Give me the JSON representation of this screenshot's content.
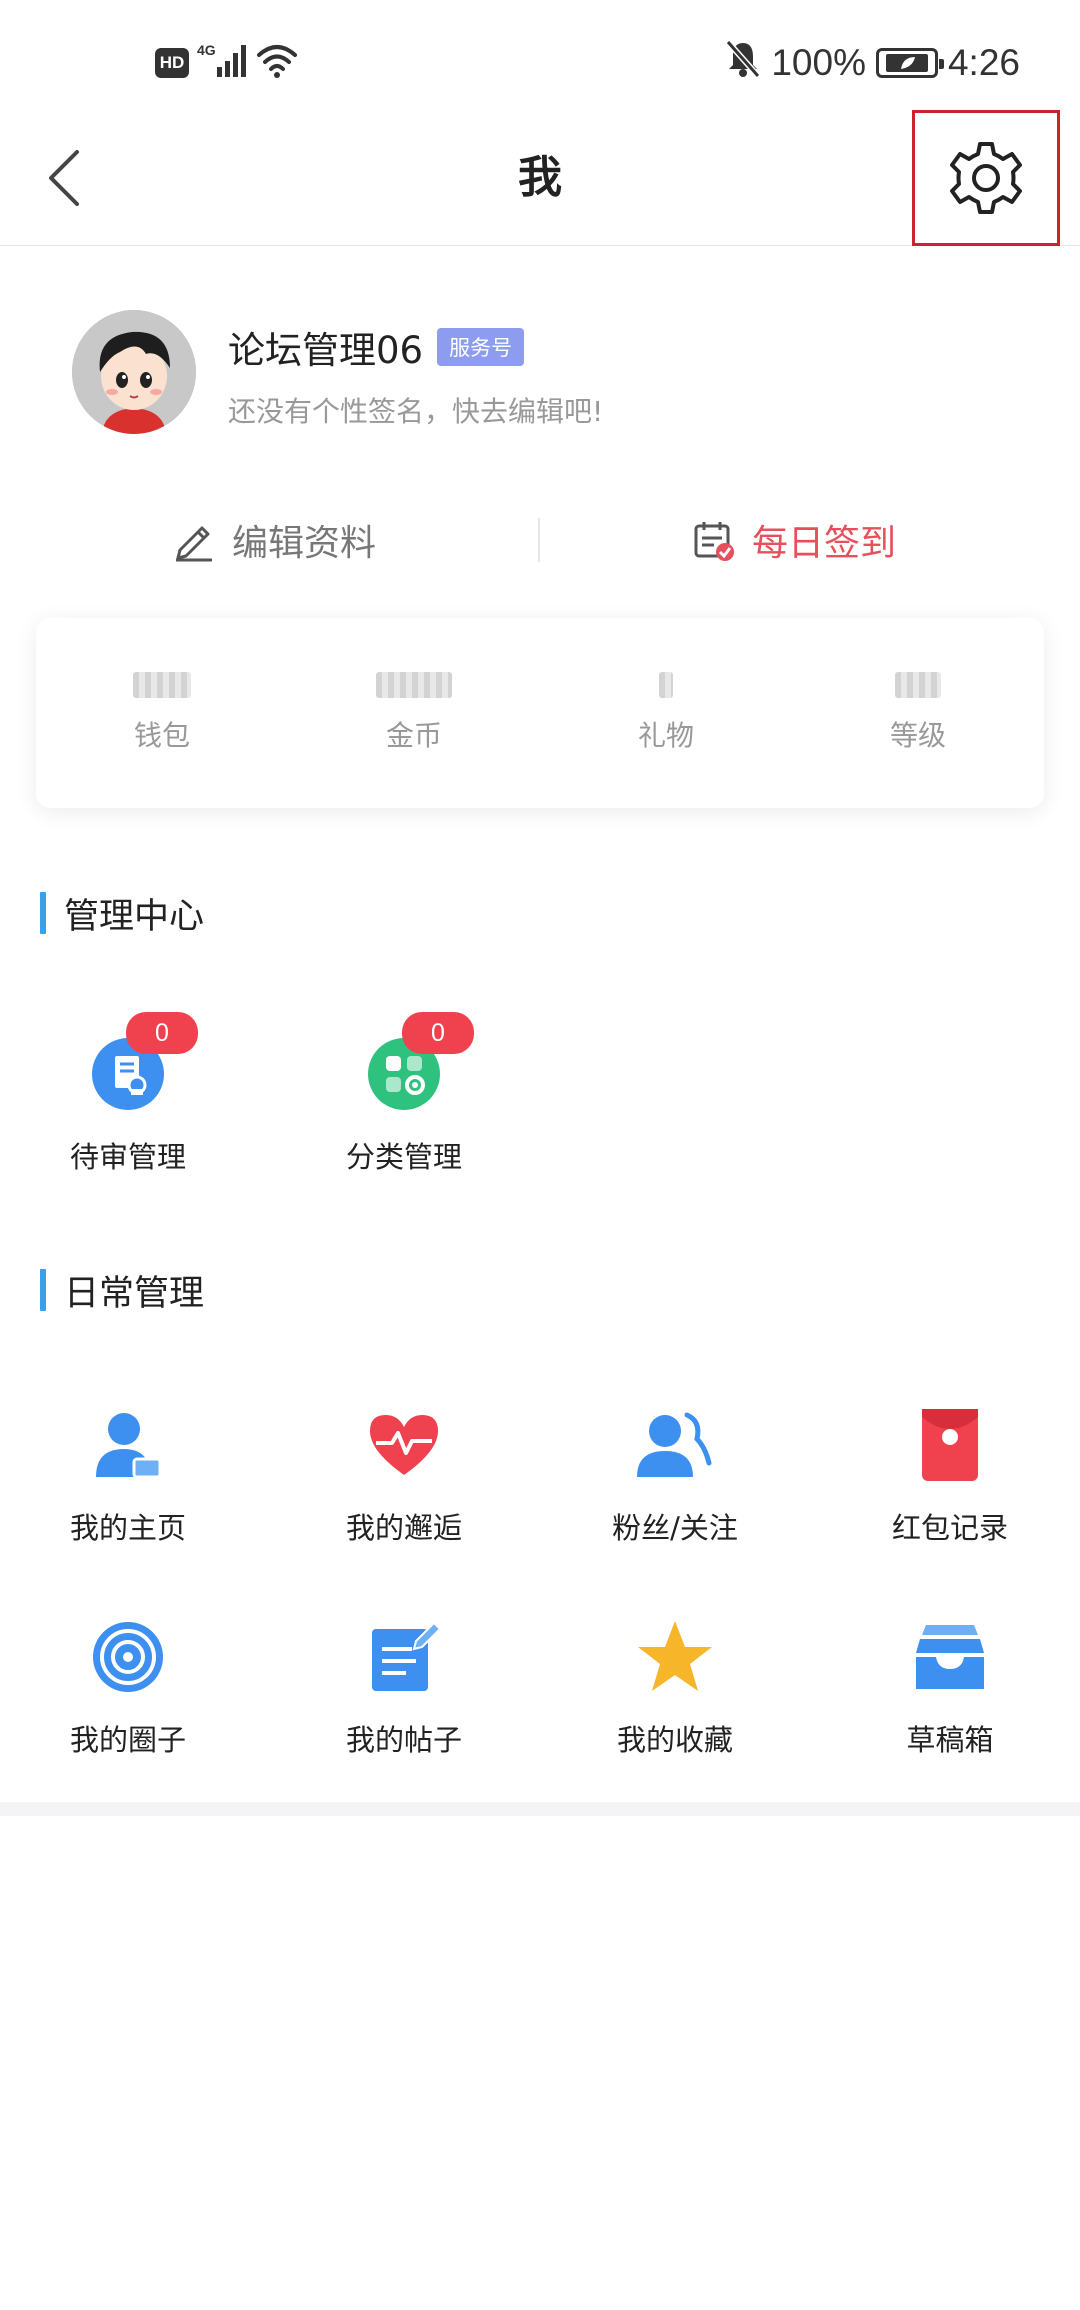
{
  "status_bar": {
    "hd": "HD",
    "network": "4G",
    "battery": "100%",
    "time": "4:26"
  },
  "nav": {
    "title": "我"
  },
  "profile": {
    "username": "论坛管理06",
    "badge": "服务号",
    "signature": "还没有个性签名，快去编辑吧!"
  },
  "actions": {
    "edit": "编辑资料",
    "checkin": "每日签到"
  },
  "stats": [
    {
      "label": "钱包"
    },
    {
      "label": "金币"
    },
    {
      "label": "礼物"
    },
    {
      "label": "等级"
    }
  ],
  "admin_center": {
    "title": "管理中心",
    "items": [
      {
        "label": "待审管理",
        "count": "0",
        "icon": "review-doc-icon"
      },
      {
        "label": "分类管理",
        "count": "0",
        "icon": "category-icon"
      }
    ]
  },
  "daily": {
    "title": "日常管理",
    "items": [
      {
        "label": "我的主页",
        "icon": "user-home-icon"
      },
      {
        "label": "我的邂逅",
        "icon": "heartbeat-icon"
      },
      {
        "label": "粉丝/关注",
        "icon": "followers-icon"
      },
      {
        "label": "红包记录",
        "icon": "red-envelope-icon"
      },
      {
        "label": "我的圈子",
        "icon": "circle-target-icon"
      },
      {
        "label": "我的帖子",
        "icon": "post-edit-icon"
      },
      {
        "label": "我的收藏",
        "icon": "star-icon"
      },
      {
        "label": "草稿箱",
        "icon": "drafts-box-icon"
      }
    ]
  },
  "colors": {
    "accent_blue": "#3aa0ea",
    "checkin_red": "#e6505c",
    "badge_red": "#f0414e",
    "highlight_box": "#d0202c",
    "service_badge": "#8e9cf0"
  }
}
